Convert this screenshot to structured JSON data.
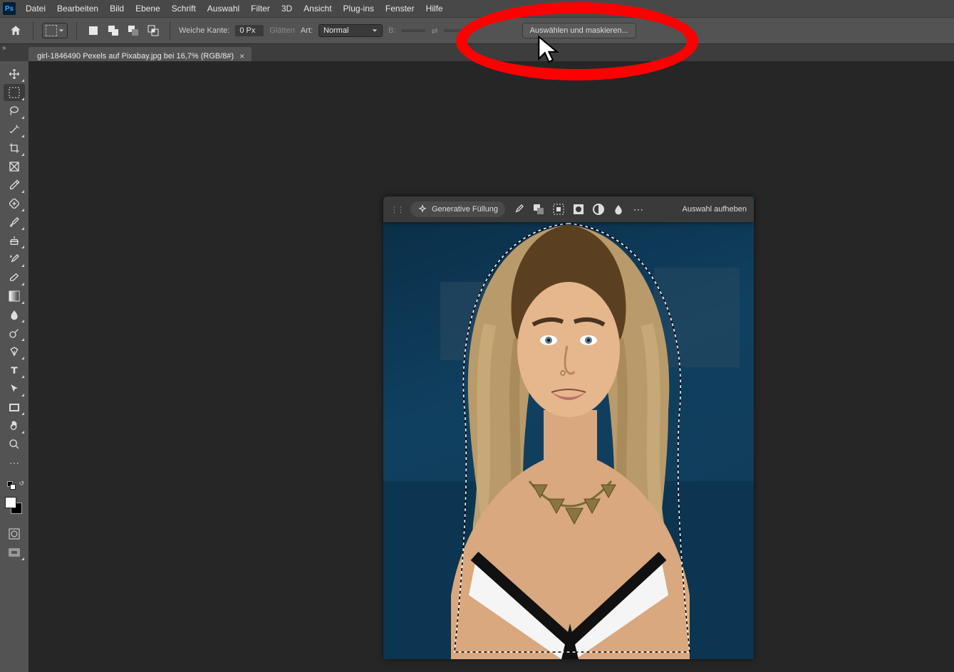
{
  "app": {
    "logo": "Ps"
  },
  "menu": {
    "items": [
      "Datei",
      "Bearbeiten",
      "Bild",
      "Ebene",
      "Schrift",
      "Auswahl",
      "Filter",
      "3D",
      "Ansicht",
      "Plug-ins",
      "Fenster",
      "Hilfe"
    ]
  },
  "options": {
    "feather_label": "Weiche Kante:",
    "feather_value": "0 Px",
    "antialias_label": "Glätten",
    "style_label": "Art:",
    "style_value": "Normal",
    "width_label": "B:",
    "select_mask_btn": "Auswählen und maskieren..."
  },
  "tab": {
    "title": "girl-1846490 Pexels auf Pixabay.jpg bei 16,7% (RGB/8#)"
  },
  "context": {
    "generative": "Generative Füllung",
    "deselect": "Auswahl aufheben"
  },
  "tools": {
    "list": [
      "move-tool",
      "marquee-tool",
      "lasso-tool",
      "magic-wand-tool",
      "crop-tool",
      "frame-tool",
      "eyedropper-tool",
      "spot-heal-tool",
      "brush-tool",
      "clone-stamp-tool",
      "history-brush-tool",
      "eraser-tool",
      "gradient-tool",
      "blur-tool",
      "dodge-tool",
      "pen-tool",
      "type-tool",
      "path-select-tool",
      "rectangle-tool",
      "hand-tool",
      "zoom-tool"
    ]
  }
}
